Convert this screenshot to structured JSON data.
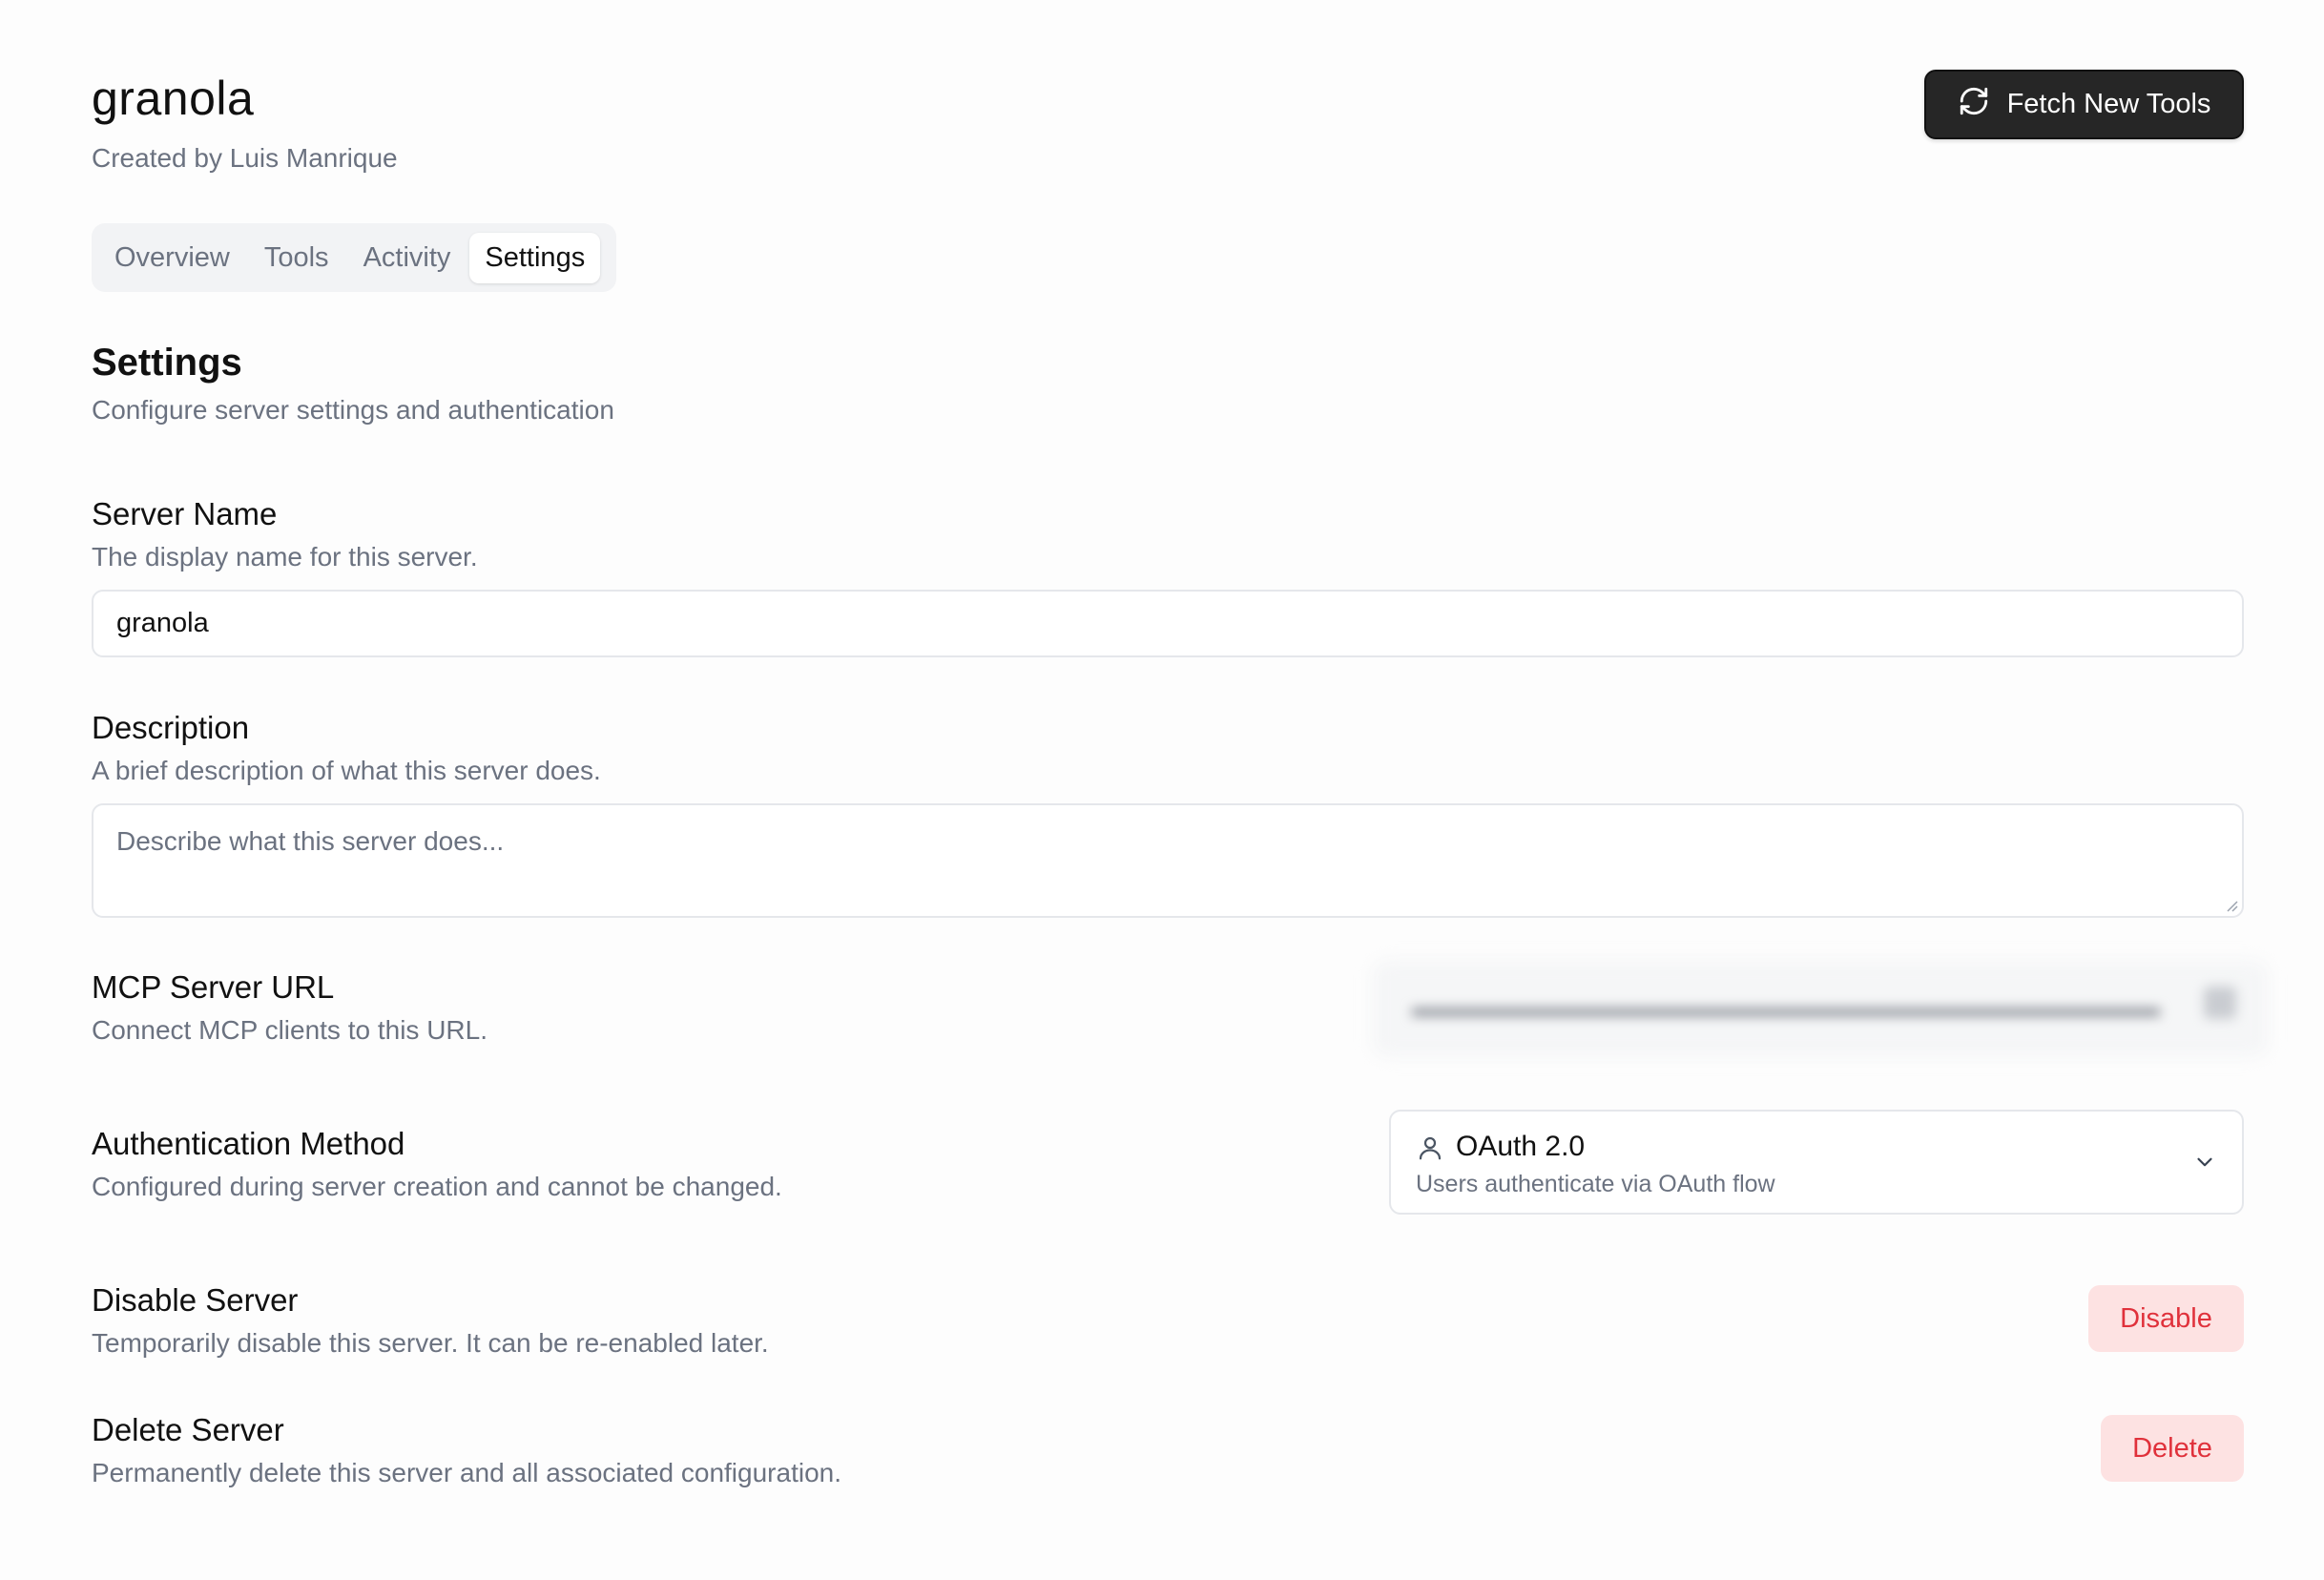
{
  "header": {
    "title": "granola",
    "created_by": "Created by Luis Manrique",
    "fetch_button_label": "Fetch New Tools",
    "fetch_icon": "refresh-icon"
  },
  "tabs": [
    {
      "label": "Overview",
      "active": false
    },
    {
      "label": "Tools",
      "active": false
    },
    {
      "label": "Activity",
      "active": false
    },
    {
      "label": "Settings",
      "active": true
    }
  ],
  "settings": {
    "title": "Settings",
    "subtitle": "Configure server settings and authentication",
    "server_name": {
      "label": "Server Name",
      "help": "The display name for this server.",
      "value": "granola"
    },
    "description": {
      "label": "Description",
      "help": "A brief description of what this server does.",
      "value": "",
      "placeholder": "Describe what this server does..."
    },
    "mcp_url": {
      "label": "MCP Server URL",
      "help": "Connect MCP clients to this URL.",
      "blurred": true
    },
    "auth": {
      "label": "Authentication Method",
      "help": "Configured during server creation and cannot be changed.",
      "selected": "OAuth 2.0",
      "selected_desc": "Users authenticate via OAuth flow",
      "icon": "user-icon"
    },
    "disable": {
      "label": "Disable Server",
      "help": "Temporarily disable this server. It can be re-enabled later.",
      "button": "Disable"
    },
    "delete": {
      "label": "Delete Server",
      "help": "Permanently delete this server and all associated configuration.",
      "button": "Delete"
    }
  },
  "colors": {
    "primary_button": "#262626",
    "danger_text": "#e0313b",
    "danger_bg": "#fde2e2",
    "muted_text": "#6b7280"
  }
}
